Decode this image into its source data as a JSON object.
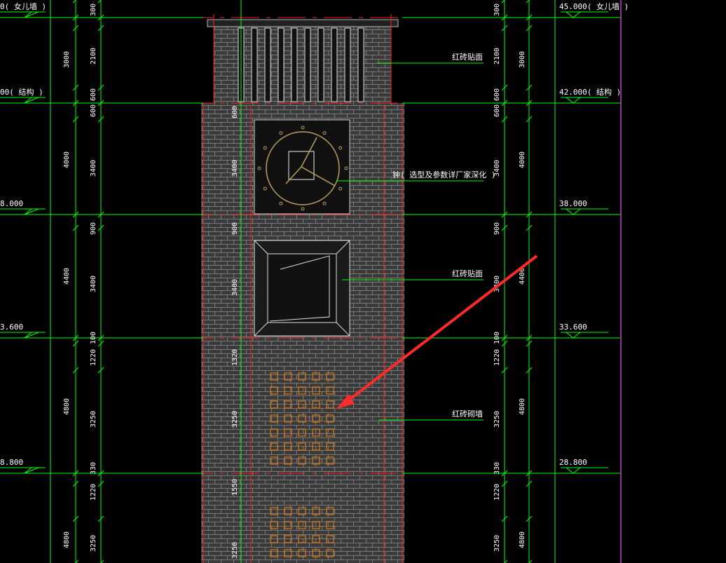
{
  "colors": {
    "background": "#000000",
    "dimension_green": "#00ff00",
    "level_red": "#ff2020",
    "brick_fill": "#3a3a3a",
    "brick_line": "#888888",
    "window_orange": "#e07a10",
    "clock_gold": "#b8a060",
    "arrow_red": "#ff2a2a",
    "boundary_magenta": "#c040c0",
    "text_white": "#ffffff"
  },
  "levels_left": [
    "0(  女儿墙 )",
    "00(  结构 )",
    "8.000",
    "3.600",
    "8.800"
  ],
  "levels_right": [
    "45.000(  女儿墙 )",
    "42.000(  结构 )",
    "38.000",
    "33.600",
    "28.800"
  ],
  "dims_outer": [
    "3000",
    "4000",
    "4400",
    "4800",
    "4800"
  ],
  "dims_inner": [
    "300",
    "2100",
    "600",
    "600",
    "3400",
    "900",
    "3400",
    "100",
    "1220",
    "3250",
    "330",
    "1220",
    "3250"
  ],
  "dims_tower": [
    "600",
    "3400",
    "900",
    "3400",
    "1320",
    "3250",
    "1550",
    "3250"
  ],
  "dims_right_outer": [
    "3000",
    "4000",
    "4400",
    "4800",
    "4800"
  ],
  "dims_right_inner": [
    "300",
    "2100",
    "600",
    "600",
    "3400",
    "900",
    "3400",
    "100",
    "1220",
    "3250",
    "330",
    "1220",
    "3250"
  ],
  "annotations": {
    "parapet_finish": "红砖贴面",
    "clock": "钟(  选型及参数详厂家深化     )",
    "panel_finish": "红砖贴面",
    "brick_wall": "红砖砌墙"
  },
  "icons": {
    "level_marker": "level-triangle-icon",
    "arrow": "red-arrow-icon",
    "clock": "clock-face-icon"
  }
}
